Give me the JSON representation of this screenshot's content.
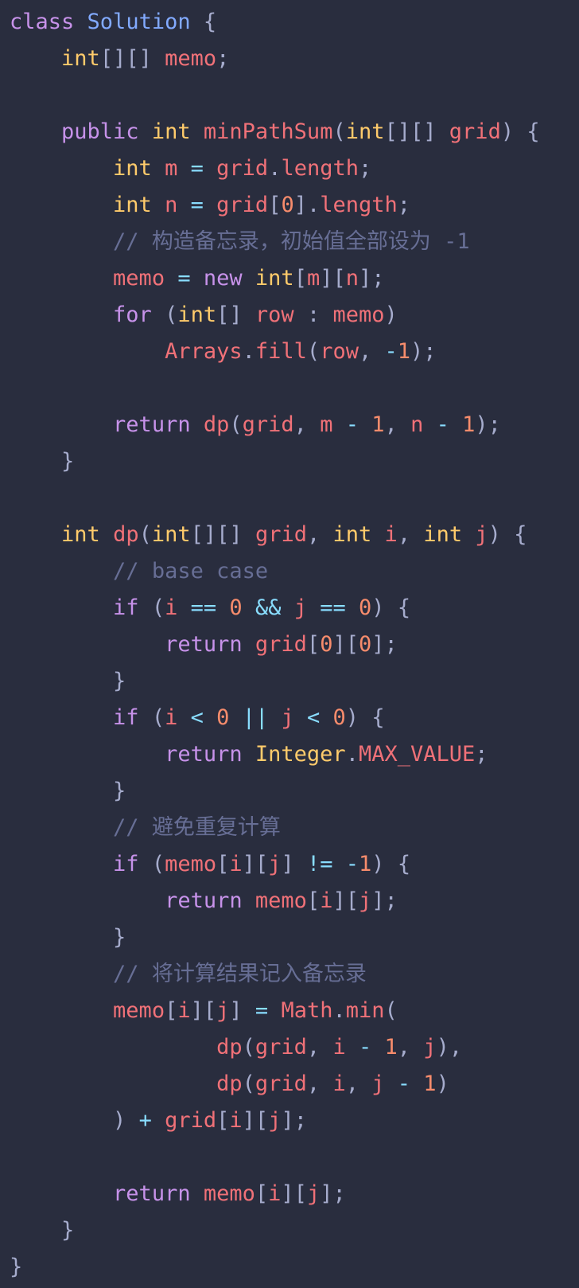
{
  "theme": {
    "background": "#292d3e",
    "colors": {
      "kw": "#c792ea",
      "type": "#ffcb6b",
      "cls": "#82aaff",
      "var": "#f07178",
      "num": "#f78c6c",
      "op": "#89ddff",
      "punc": "#a6accd",
      "cmt": "#676e95",
      "plain": "#a6accd"
    }
  },
  "editor": {
    "language": "java",
    "lines": [
      [
        [
          "kw",
          "class"
        ],
        [
          "plain",
          " "
        ],
        [
          "cls",
          "Solution"
        ],
        [
          "plain",
          " "
        ],
        [
          "punc",
          "{"
        ]
      ],
      [
        [
          "plain",
          "    "
        ],
        [
          "type",
          "int"
        ],
        [
          "punc",
          "[][]"
        ],
        [
          "plain",
          " "
        ],
        [
          "var",
          "memo"
        ],
        [
          "punc",
          ";"
        ]
      ],
      [],
      [
        [
          "plain",
          "    "
        ],
        [
          "kw",
          "public"
        ],
        [
          "plain",
          " "
        ],
        [
          "type",
          "int"
        ],
        [
          "plain",
          " "
        ],
        [
          "var",
          "minPathSum"
        ],
        [
          "punc",
          "("
        ],
        [
          "type",
          "int"
        ],
        [
          "punc",
          "[][]"
        ],
        [
          "plain",
          " "
        ],
        [
          "var",
          "grid"
        ],
        [
          "punc",
          ")"
        ],
        [
          "plain",
          " "
        ],
        [
          "punc",
          "{"
        ]
      ],
      [
        [
          "plain",
          "        "
        ],
        [
          "type",
          "int"
        ],
        [
          "plain",
          " "
        ],
        [
          "var",
          "m"
        ],
        [
          "plain",
          " "
        ],
        [
          "op",
          "="
        ],
        [
          "plain",
          " "
        ],
        [
          "var",
          "grid"
        ],
        [
          "punc",
          "."
        ],
        [
          "var",
          "length"
        ],
        [
          "punc",
          ";"
        ]
      ],
      [
        [
          "plain",
          "        "
        ],
        [
          "type",
          "int"
        ],
        [
          "plain",
          " "
        ],
        [
          "var",
          "n"
        ],
        [
          "plain",
          " "
        ],
        [
          "op",
          "="
        ],
        [
          "plain",
          " "
        ],
        [
          "var",
          "grid"
        ],
        [
          "punc",
          "["
        ],
        [
          "num",
          "0"
        ],
        [
          "punc",
          "]."
        ],
        [
          "var",
          "length"
        ],
        [
          "punc",
          ";"
        ]
      ],
      [
        [
          "plain",
          "        "
        ],
        [
          "cmt",
          "// 构造备忘录，初始值全部设为 -1"
        ]
      ],
      [
        [
          "plain",
          "        "
        ],
        [
          "var",
          "memo"
        ],
        [
          "plain",
          " "
        ],
        [
          "op",
          "="
        ],
        [
          "plain",
          " "
        ],
        [
          "kw",
          "new"
        ],
        [
          "plain",
          " "
        ],
        [
          "type",
          "int"
        ],
        [
          "punc",
          "["
        ],
        [
          "var",
          "m"
        ],
        [
          "punc",
          "]["
        ],
        [
          "var",
          "n"
        ],
        [
          "punc",
          "];"
        ]
      ],
      [
        [
          "plain",
          "        "
        ],
        [
          "kw",
          "for"
        ],
        [
          "plain",
          " "
        ],
        [
          "punc",
          "("
        ],
        [
          "type",
          "int"
        ],
        [
          "punc",
          "[]"
        ],
        [
          "plain",
          " "
        ],
        [
          "var",
          "row"
        ],
        [
          "plain",
          " "
        ],
        [
          "punc",
          ":"
        ],
        [
          "plain",
          " "
        ],
        [
          "var",
          "memo"
        ],
        [
          "punc",
          ")"
        ]
      ],
      [
        [
          "plain",
          "            "
        ],
        [
          "var",
          "Arrays"
        ],
        [
          "punc",
          "."
        ],
        [
          "var",
          "fill"
        ],
        [
          "punc",
          "("
        ],
        [
          "var",
          "row"
        ],
        [
          "punc",
          ","
        ],
        [
          "plain",
          " "
        ],
        [
          "op",
          "-"
        ],
        [
          "num",
          "1"
        ],
        [
          "punc",
          ");"
        ]
      ],
      [],
      [
        [
          "plain",
          "        "
        ],
        [
          "kw",
          "return"
        ],
        [
          "plain",
          " "
        ],
        [
          "var",
          "dp"
        ],
        [
          "punc",
          "("
        ],
        [
          "var",
          "grid"
        ],
        [
          "punc",
          ","
        ],
        [
          "plain",
          " "
        ],
        [
          "var",
          "m"
        ],
        [
          "plain",
          " "
        ],
        [
          "op",
          "-"
        ],
        [
          "plain",
          " "
        ],
        [
          "num",
          "1"
        ],
        [
          "punc",
          ","
        ],
        [
          "plain",
          " "
        ],
        [
          "var",
          "n"
        ],
        [
          "plain",
          " "
        ],
        [
          "op",
          "-"
        ],
        [
          "plain",
          " "
        ],
        [
          "num",
          "1"
        ],
        [
          "punc",
          ");"
        ]
      ],
      [
        [
          "plain",
          "    "
        ],
        [
          "punc",
          "}"
        ]
      ],
      [],
      [
        [
          "plain",
          "    "
        ],
        [
          "type",
          "int"
        ],
        [
          "plain",
          " "
        ],
        [
          "var",
          "dp"
        ],
        [
          "punc",
          "("
        ],
        [
          "type",
          "int"
        ],
        [
          "punc",
          "[][]"
        ],
        [
          "plain",
          " "
        ],
        [
          "var",
          "grid"
        ],
        [
          "punc",
          ","
        ],
        [
          "plain",
          " "
        ],
        [
          "type",
          "int"
        ],
        [
          "plain",
          " "
        ],
        [
          "var",
          "i"
        ],
        [
          "punc",
          ","
        ],
        [
          "plain",
          " "
        ],
        [
          "type",
          "int"
        ],
        [
          "plain",
          " "
        ],
        [
          "var",
          "j"
        ],
        [
          "punc",
          ")"
        ],
        [
          "plain",
          " "
        ],
        [
          "punc",
          "{"
        ]
      ],
      [
        [
          "plain",
          "        "
        ],
        [
          "cmt",
          "// base case"
        ]
      ],
      [
        [
          "plain",
          "        "
        ],
        [
          "kw",
          "if"
        ],
        [
          "plain",
          " "
        ],
        [
          "punc",
          "("
        ],
        [
          "var",
          "i"
        ],
        [
          "plain",
          " "
        ],
        [
          "op",
          "=="
        ],
        [
          "plain",
          " "
        ],
        [
          "num",
          "0"
        ],
        [
          "plain",
          " "
        ],
        [
          "op",
          "&&"
        ],
        [
          "plain",
          " "
        ],
        [
          "var",
          "j"
        ],
        [
          "plain",
          " "
        ],
        [
          "op",
          "=="
        ],
        [
          "plain",
          " "
        ],
        [
          "num",
          "0"
        ],
        [
          "punc",
          ")"
        ],
        [
          "plain",
          " "
        ],
        [
          "punc",
          "{"
        ]
      ],
      [
        [
          "plain",
          "            "
        ],
        [
          "kw",
          "return"
        ],
        [
          "plain",
          " "
        ],
        [
          "var",
          "grid"
        ],
        [
          "punc",
          "["
        ],
        [
          "num",
          "0"
        ],
        [
          "punc",
          "]["
        ],
        [
          "num",
          "0"
        ],
        [
          "punc",
          "];"
        ]
      ],
      [
        [
          "plain",
          "        "
        ],
        [
          "punc",
          "}"
        ]
      ],
      [
        [
          "plain",
          "        "
        ],
        [
          "kw",
          "if"
        ],
        [
          "plain",
          " "
        ],
        [
          "punc",
          "("
        ],
        [
          "var",
          "i"
        ],
        [
          "plain",
          " "
        ],
        [
          "op",
          "<"
        ],
        [
          "plain",
          " "
        ],
        [
          "num",
          "0"
        ],
        [
          "plain",
          " "
        ],
        [
          "op",
          "||"
        ],
        [
          "plain",
          " "
        ],
        [
          "var",
          "j"
        ],
        [
          "plain",
          " "
        ],
        [
          "op",
          "<"
        ],
        [
          "plain",
          " "
        ],
        [
          "num",
          "0"
        ],
        [
          "punc",
          ")"
        ],
        [
          "plain",
          " "
        ],
        [
          "punc",
          "{"
        ]
      ],
      [
        [
          "plain",
          "            "
        ],
        [
          "kw",
          "return"
        ],
        [
          "plain",
          " "
        ],
        [
          "type",
          "Integer"
        ],
        [
          "punc",
          "."
        ],
        [
          "var",
          "MAX_VALUE"
        ],
        [
          "punc",
          ";"
        ]
      ],
      [
        [
          "plain",
          "        "
        ],
        [
          "punc",
          "}"
        ]
      ],
      [
        [
          "plain",
          "        "
        ],
        [
          "cmt",
          "// 避免重复计算"
        ]
      ],
      [
        [
          "plain",
          "        "
        ],
        [
          "kw",
          "if"
        ],
        [
          "plain",
          " "
        ],
        [
          "punc",
          "("
        ],
        [
          "var",
          "memo"
        ],
        [
          "punc",
          "["
        ],
        [
          "var",
          "i"
        ],
        [
          "punc",
          "]["
        ],
        [
          "var",
          "j"
        ],
        [
          "punc",
          "]"
        ],
        [
          "plain",
          " "
        ],
        [
          "op",
          "!="
        ],
        [
          "plain",
          " "
        ],
        [
          "op",
          "-"
        ],
        [
          "num",
          "1"
        ],
        [
          "punc",
          ")"
        ],
        [
          "plain",
          " "
        ],
        [
          "punc",
          "{"
        ]
      ],
      [
        [
          "plain",
          "            "
        ],
        [
          "kw",
          "return"
        ],
        [
          "plain",
          " "
        ],
        [
          "var",
          "memo"
        ],
        [
          "punc",
          "["
        ],
        [
          "var",
          "i"
        ],
        [
          "punc",
          "]["
        ],
        [
          "var",
          "j"
        ],
        [
          "punc",
          "];"
        ]
      ],
      [
        [
          "plain",
          "        "
        ],
        [
          "punc",
          "}"
        ]
      ],
      [
        [
          "plain",
          "        "
        ],
        [
          "cmt",
          "// 将计算结果记入备忘录"
        ]
      ],
      [
        [
          "plain",
          "        "
        ],
        [
          "var",
          "memo"
        ],
        [
          "punc",
          "["
        ],
        [
          "var",
          "i"
        ],
        [
          "punc",
          "]["
        ],
        [
          "var",
          "j"
        ],
        [
          "punc",
          "]"
        ],
        [
          "plain",
          " "
        ],
        [
          "op",
          "="
        ],
        [
          "plain",
          " "
        ],
        [
          "var",
          "Math"
        ],
        [
          "punc",
          "."
        ],
        [
          "var",
          "min"
        ],
        [
          "punc",
          "("
        ]
      ],
      [
        [
          "plain",
          "                "
        ],
        [
          "var",
          "dp"
        ],
        [
          "punc",
          "("
        ],
        [
          "var",
          "grid"
        ],
        [
          "punc",
          ","
        ],
        [
          "plain",
          " "
        ],
        [
          "var",
          "i"
        ],
        [
          "plain",
          " "
        ],
        [
          "op",
          "-"
        ],
        [
          "plain",
          " "
        ],
        [
          "num",
          "1"
        ],
        [
          "punc",
          ","
        ],
        [
          "plain",
          " "
        ],
        [
          "var",
          "j"
        ],
        [
          "punc",
          "),"
        ]
      ],
      [
        [
          "plain",
          "                "
        ],
        [
          "var",
          "dp"
        ],
        [
          "punc",
          "("
        ],
        [
          "var",
          "grid"
        ],
        [
          "punc",
          ","
        ],
        [
          "plain",
          " "
        ],
        [
          "var",
          "i"
        ],
        [
          "punc",
          ","
        ],
        [
          "plain",
          " "
        ],
        [
          "var",
          "j"
        ],
        [
          "plain",
          " "
        ],
        [
          "op",
          "-"
        ],
        [
          "plain",
          " "
        ],
        [
          "num",
          "1"
        ],
        [
          "punc",
          ")"
        ]
      ],
      [
        [
          "plain",
          "        "
        ],
        [
          "punc",
          ")"
        ],
        [
          "plain",
          " "
        ],
        [
          "op",
          "+"
        ],
        [
          "plain",
          " "
        ],
        [
          "var",
          "grid"
        ],
        [
          "punc",
          "["
        ],
        [
          "var",
          "i"
        ],
        [
          "punc",
          "]["
        ],
        [
          "var",
          "j"
        ],
        [
          "punc",
          "];"
        ]
      ],
      [],
      [
        [
          "plain",
          "        "
        ],
        [
          "kw",
          "return"
        ],
        [
          "plain",
          " "
        ],
        [
          "var",
          "memo"
        ],
        [
          "punc",
          "["
        ],
        [
          "var",
          "i"
        ],
        [
          "punc",
          "]["
        ],
        [
          "var",
          "j"
        ],
        [
          "punc",
          "];"
        ]
      ],
      [
        [
          "plain",
          "    "
        ],
        [
          "punc",
          "}"
        ]
      ],
      [
        [
          "punc",
          "}"
        ]
      ]
    ]
  }
}
